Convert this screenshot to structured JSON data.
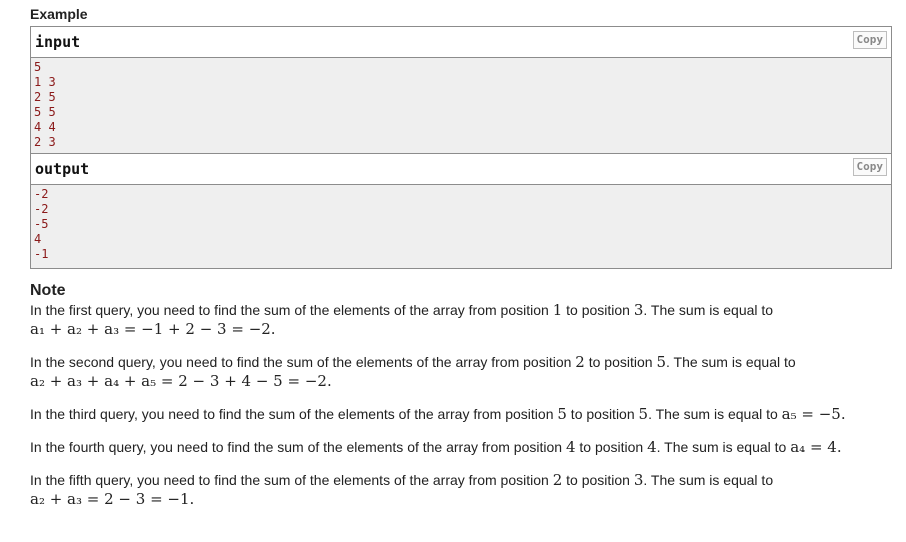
{
  "example_title": "Example",
  "copy_label": "Copy",
  "input": {
    "label": "input",
    "lines": [
      "5",
      "1 3",
      "2 5",
      "5 5",
      "4 4",
      "2 3"
    ]
  },
  "output": {
    "label": "output",
    "lines": [
      "-2",
      "-2",
      "-5",
      "4",
      "-1"
    ]
  },
  "note_title": "Note",
  "notes": [
    {
      "pre": "In the first query, you need to find the sum of the elements of the array from position ",
      "from": "1",
      "mid": " to position ",
      "to": "3",
      "post": ". The sum is equal to",
      "formula": "a₁ + a₂ + a₃ = −1 + 2 − 3 = −2."
    },
    {
      "pre": "In the second query, you need to find the sum of the elements of the array from position ",
      "from": "2",
      "mid": " to position ",
      "to": "5",
      "post": ". The sum is equal to",
      "formula": "a₂ + a₃ + a₄ + a₅ = 2 − 3 + 4 − 5 = −2."
    },
    {
      "pre": "In the third query, you need to find the sum of the elements of the array from position ",
      "from": "5",
      "mid": " to position ",
      "to": "5",
      "post": ". The sum is equal to ",
      "formula": "a₅ = −5."
    },
    {
      "pre": "In the fourth query, you need to find the sum of the elements of the array from position ",
      "from": "4",
      "mid": " to position ",
      "to": "4",
      "post": ". The sum is equal to ",
      "formula": "a₄ = 4."
    },
    {
      "pre": "In the fifth query, you need to find the sum of the elements of the array from position ",
      "from": "2",
      "mid": " to position ",
      "to": "3",
      "post": ". The sum is equal to",
      "formula": "a₂ + a₃ = 2 − 3 = −1."
    }
  ]
}
